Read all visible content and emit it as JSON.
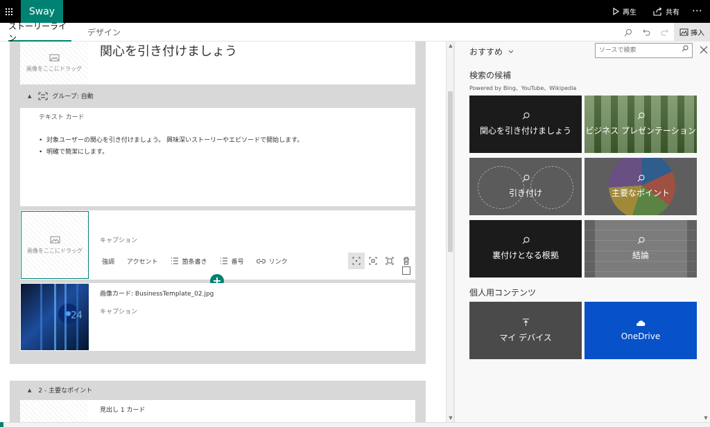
{
  "app": {
    "name": "Sway",
    "actions": {
      "play": "再生",
      "share": "共有",
      "more": "⋯"
    }
  },
  "tabs": [
    {
      "label": "ストーリーライン",
      "active": true
    },
    {
      "label": "デザイン",
      "active": false
    }
  ],
  "toolbar": {
    "insert_label": "挿入"
  },
  "storyline": {
    "top_card": {
      "drop_text": "画像をここにドラッグ",
      "heading": "関心を引き付けましょう"
    },
    "group": {
      "label": "グループ: 自動"
    },
    "text_card": {
      "label": "テキスト カード",
      "bullets": [
        "対象ユーザーの関心を引き付けましょう。 興味深いストーリーやエピソードで開始します。",
        "明確で簡潔にします。"
      ]
    },
    "format_toolbar": {
      "bold": "強調",
      "accent": "アクセント",
      "bullets": "箇条書き",
      "numbered": "番号",
      "link": "リンク"
    },
    "caption_card": {
      "drop_text": "画像をここにドラッグ",
      "caption": "キャプション"
    },
    "image_card": {
      "title": "画像カード: BusinessTemplate_02.jpg",
      "caption": "キャプション"
    },
    "section_2": {
      "label": "2 - 主要なポイント",
      "heading_card": "見出し 1 カード"
    }
  },
  "panel": {
    "recommended": "おすすめ",
    "search_placeholder": "ソースで検索",
    "suggestions_title": "検索の候補",
    "powered_by": "Powered by Bing、YouTube、Wikipedia",
    "suggestions": [
      {
        "label": "関心を引き付けましょう",
        "icon": "search-icon"
      },
      {
        "label": "ビジネス プレゼンテーション",
        "icon": "search-icon"
      },
      {
        "label": "引き付け",
        "icon": "search-icon"
      },
      {
        "label": "主要なポイント",
        "icon": "search-icon"
      },
      {
        "label": "裏付けとなる根拠",
        "icon": "search-icon"
      },
      {
        "label": "結論",
        "icon": "search-icon"
      }
    ],
    "personal_title": "個人用コンテンツ",
    "personal": [
      {
        "label": "マイ デバイス",
        "icon": "upload-icon"
      },
      {
        "label": "OneDrive",
        "icon": "cloud-icon"
      }
    ]
  },
  "colors": {
    "accent": "#008272",
    "top_bar": "#000000",
    "onedrive": "#0751c9"
  }
}
